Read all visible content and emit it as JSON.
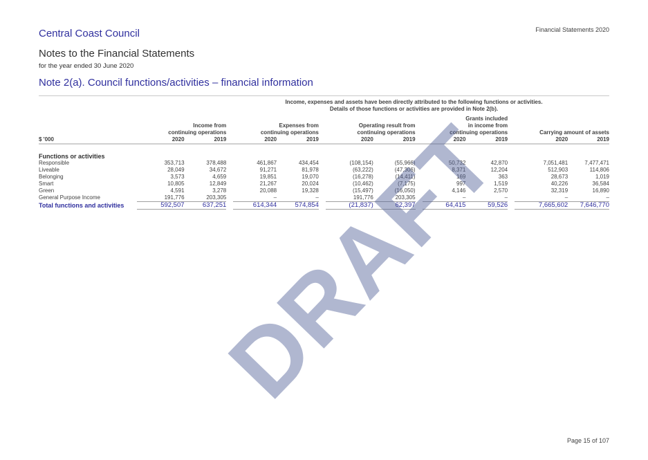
{
  "header": {
    "organisation": "Central Coast Council",
    "running_head": "Financial Statements 2020",
    "title": "Notes to the Financial Statements",
    "subtitle": "for the year ended 30 June 2020",
    "note_title": "Note 2(a). Council functions/activities – financial information"
  },
  "intro": {
    "line1": "Income, expenses and assets have been directly attributed to the following functions or activities.",
    "line2": "Details of those functions or activities are provided in Note 2(b)."
  },
  "table": {
    "unit_label": "$ '000",
    "column_groups": [
      {
        "line1": "",
        "line2": "Income from",
        "line3": "continuing operations"
      },
      {
        "line1": "",
        "line2": "Expenses from",
        "line3": "continuing operations"
      },
      {
        "line1": "",
        "line2": "Operating result from",
        "line3": "continuing operations"
      },
      {
        "line1": "Grants included",
        "line2": "in income from",
        "line3": "continuing operations"
      },
      {
        "line1": "",
        "line2": "",
        "line3": "Carrying amount of assets"
      }
    ],
    "years": [
      "2020",
      "2019"
    ],
    "section_label": "Functions or activities",
    "rows": [
      {
        "label": "Responsible",
        "values": [
          "353,713",
          "378,488",
          "461,867",
          "434,454",
          "(108,154)",
          "(55,966)",
          "50,732",
          "42,870",
          "7,051,481",
          "7,477,471"
        ]
      },
      {
        "label": "Liveable",
        "values": [
          "28,049",
          "34,672",
          "91,271",
          "81,978",
          "(63,222)",
          "(47,306)",
          "8,371",
          "12,204",
          "512,903",
          "114,806"
        ]
      },
      {
        "label": "Belonging",
        "values": [
          "3,573",
          "4,659",
          "19,851",
          "19,070",
          "(16,278)",
          "(14,411)",
          "169",
          "363",
          "28,673",
          "1,019"
        ]
      },
      {
        "label": "Smart",
        "values": [
          "10,805",
          "12,849",
          "21,267",
          "20,024",
          "(10,462)",
          "(7,175)",
          "997",
          "1,519",
          "40,226",
          "36,584"
        ]
      },
      {
        "label": "Green",
        "values": [
          "4,591",
          "3,278",
          "20,088",
          "19,328",
          "(15,497)",
          "(16,050)",
          "4,146",
          "2,570",
          "32,319",
          "16,890"
        ]
      },
      {
        "label": "General Purpose Income",
        "values": [
          "191,776",
          "203,305",
          "–",
          "–",
          "191,776",
          "203,305",
          "–",
          "–",
          "–",
          "–"
        ]
      }
    ],
    "total": {
      "label": "Total functions and activities",
      "values": [
        "592,507",
        "637,251",
        "614,344",
        "574,854",
        "(21,837)",
        "62,397",
        "64,415",
        "59,526",
        "7,665,602",
        "7,646,770"
      ]
    }
  },
  "watermark": "DRAFT",
  "footer": {
    "page": "Page 15 of 107"
  },
  "colors": {
    "accent": "#2f2f9e",
    "text": "#404040",
    "watermark": "#8a94bd"
  }
}
